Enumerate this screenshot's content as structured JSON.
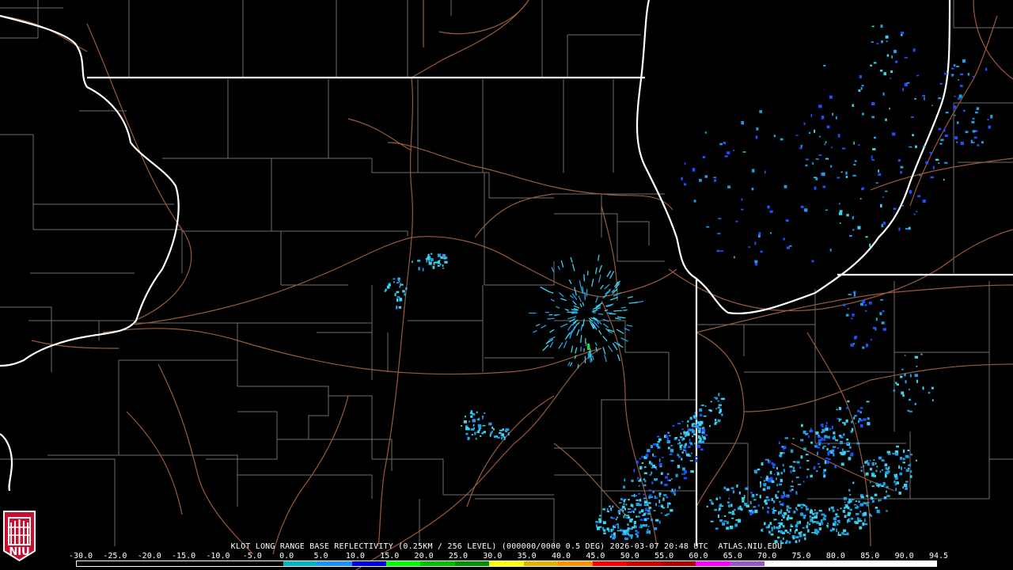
{
  "product_label": "KLOT LONG RANGE BASE REFLECTIVITY (0.25KM / 256 LEVEL) (000000/0000 0.5 DEG) 2026-03-07 20:48 UTC  ATLAS.NIU.EDU",
  "scale": {
    "labels": [
      "-30.0",
      "-25.0",
      "-20.0",
      "-15.0",
      "-10.0",
      "-5.0",
      "0.0",
      "5.0",
      "10.0",
      "15.0",
      "20.0",
      "25.0",
      "30.0",
      "35.0",
      "40.0",
      "45.0",
      "50.0",
      "55.0",
      "60.0",
      "65.0",
      "70.0",
      "75.0",
      "80.0",
      "85.0",
      "90.0",
      "94.5"
    ],
    "colors": [
      "#000000",
      "#000000",
      "#000000",
      "#000000",
      "#000000",
      "#000000",
      "#00b4c8",
      "#1e90ff",
      "#0000e8",
      "#00ff00",
      "#00c000",
      "#009000",
      "#ffff00",
      "#e6b400",
      "#ff9000",
      "#ff0000",
      "#d40000",
      "#b00000",
      "#ff00ff",
      "#9955c9",
      "#ffffff",
      "#ffffff",
      "#ffffff",
      "#ffffff",
      "#ffffff"
    ]
  },
  "logo": {
    "text": "NIU",
    "color": "#c8102e"
  },
  "colors": {
    "state_border": "#ffffff",
    "county_border": "#6e6e6e",
    "highway": "#9a5a3a",
    "light_echo": "#1ea0e6",
    "moderate_echo": "#3cd2f0",
    "strong_echo": "#1e50ff",
    "green_echo": "#28dc28"
  },
  "icons": [
    "niu-logo-icon"
  ]
}
